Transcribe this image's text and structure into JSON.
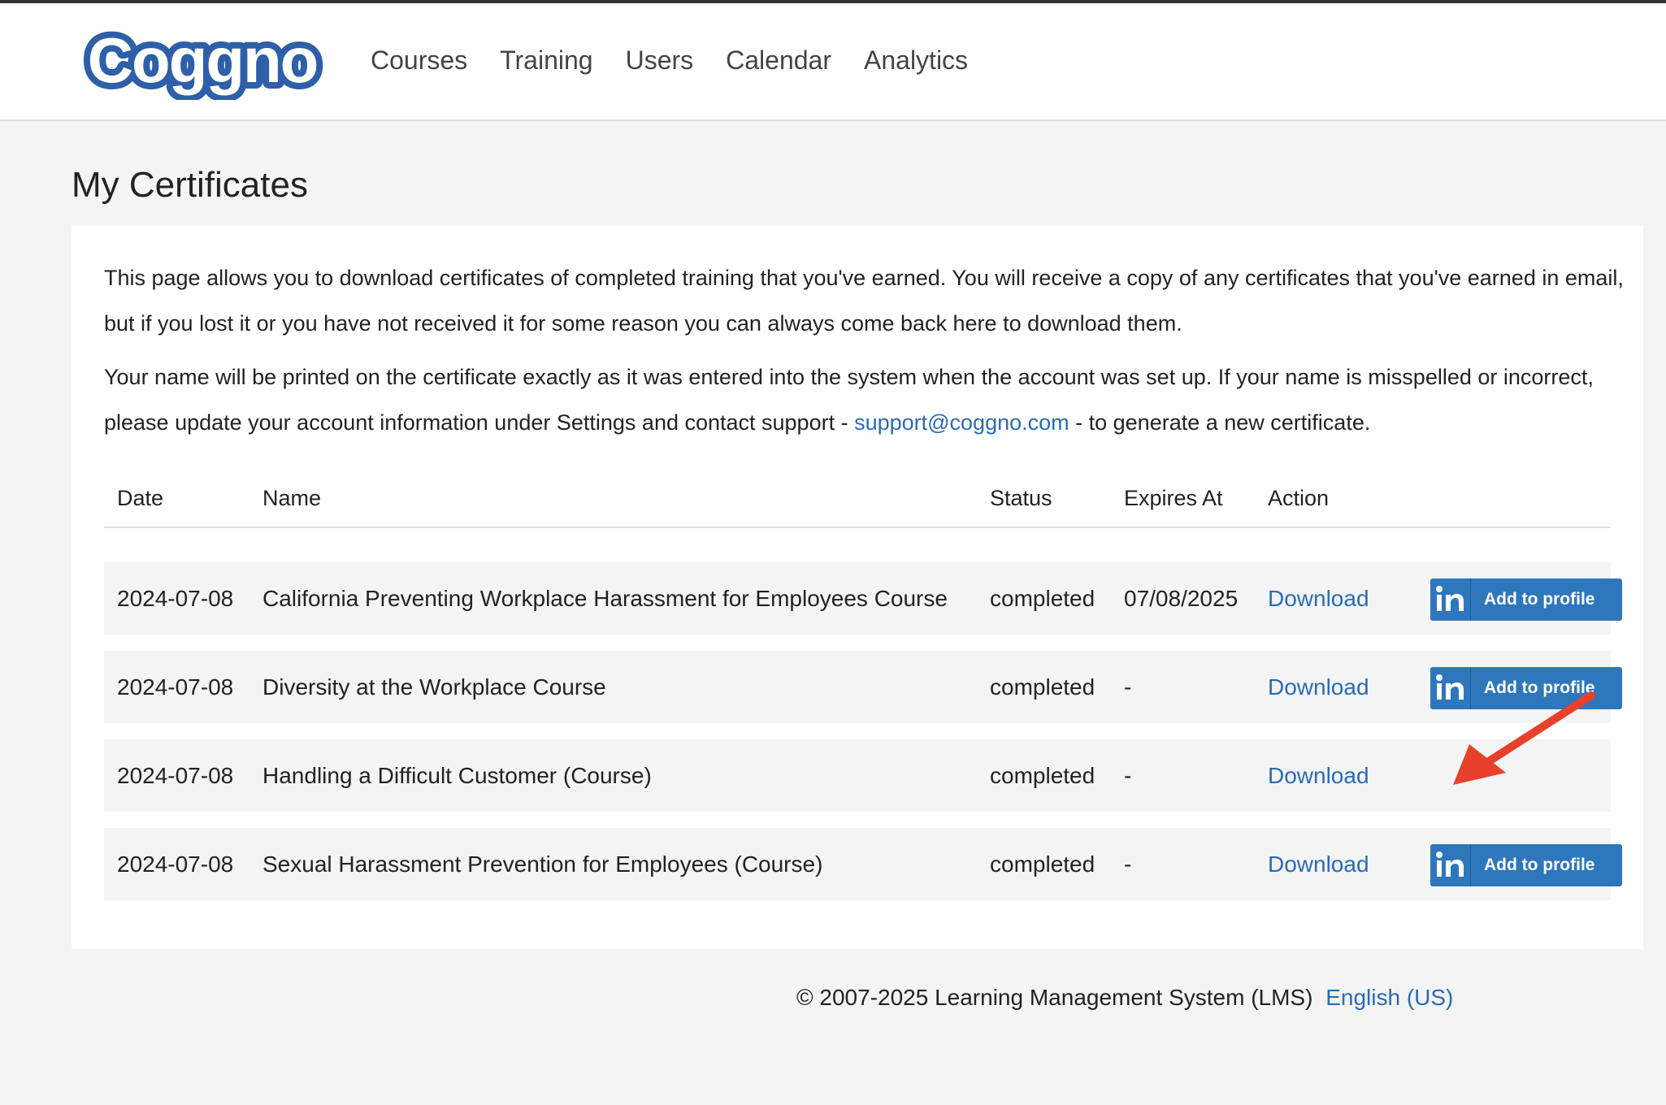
{
  "brand": {
    "logo_text": "Coggno",
    "color": "#2e5fa8"
  },
  "nav": [
    "Courses",
    "Training",
    "Users",
    "Calendar",
    "Analytics"
  ],
  "page_title": "My Certificates",
  "intro": {
    "p1": "This page allows you to download certificates of completed training that you've earned. You will receive a copy of any certificates that you've earned in email, but if you lost it or you have not received it for some reason you can always come back here to download them.",
    "p2_before": "Your name will be printed on the certificate exactly as it was entered into the system when the account was set up. If your name is misspelled or incorrect, please update your account information under Settings and contact support - ",
    "support_email": "support@coggno.com",
    "p2_after": " - to generate a new certificate."
  },
  "table": {
    "headers": {
      "date": "Date",
      "name": "Name",
      "status": "Status",
      "expires": "Expires At",
      "action": "Action"
    },
    "rows": [
      {
        "date": "2024-07-08",
        "name": "California Preventing Workplace Harassment for Employees Course",
        "status": "completed",
        "expires": "07/08/2025",
        "action": "Download",
        "linkedin": true
      },
      {
        "date": "2024-07-08",
        "name": "Diversity at the Workplace Course",
        "status": "completed",
        "expires": "-",
        "action": "Download",
        "linkedin": true
      },
      {
        "date": "2024-07-08",
        "name": "Handling a Difficult Customer (Course)",
        "status": "completed",
        "expires": "-",
        "action": "Download",
        "linkedin": false
      },
      {
        "date": "2024-07-08",
        "name": "Sexual Harassment Prevention for Employees (Course)",
        "status": "completed",
        "expires": "-",
        "action": "Download",
        "linkedin": true
      }
    ],
    "linkedin_label": "Add to profile",
    "linkedin_icon": "linkedin-in-icon"
  },
  "annotation": {
    "arrow_color": "#e8402a"
  },
  "footer": {
    "copyright": "© 2007-2025 Learning Management System (LMS)",
    "language": "English (US)"
  }
}
